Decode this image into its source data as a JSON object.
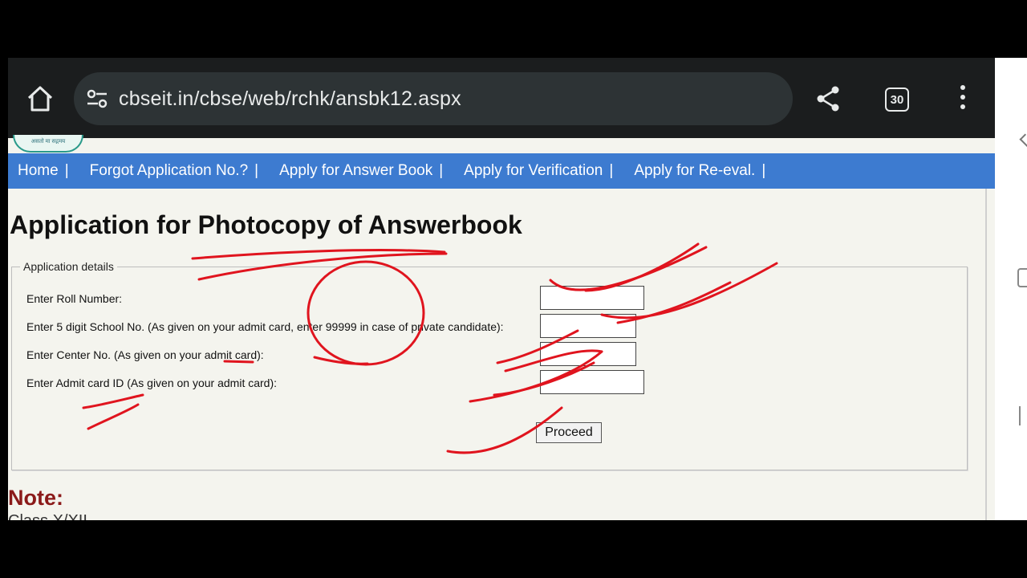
{
  "browser": {
    "url": "cbseit.in/cbse/web/rchk/ansbk12.aspx",
    "tab_count": "30"
  },
  "logo": {
    "caption": "असतो मा सद्गमय"
  },
  "nav": {
    "items": [
      {
        "label": "Home"
      },
      {
        "label": "Forgot Application No.?"
      },
      {
        "label": "Apply for Answer Book"
      },
      {
        "label": "Apply for Verification"
      },
      {
        "label": "Apply for Re-eval."
      }
    ],
    "separator": "|"
  },
  "page": {
    "title": "Application for Photocopy of Answerbook"
  },
  "form": {
    "legend": "Application details",
    "fields": [
      {
        "label": "Enter Roll Number:",
        "value": ""
      },
      {
        "label": "Enter 5 digit School No. (As given on your admit card, enter 99999 in case of private candidate):",
        "value": ""
      },
      {
        "label": "Enter Center No. (As given on your admit card):",
        "value": ""
      },
      {
        "label": "Enter Admit card ID (As given on your admit card):",
        "value": ""
      }
    ],
    "submit_label": "Proceed"
  },
  "note": {
    "title": "Note:",
    "partial_text": "Class X/XII"
  },
  "colors": {
    "nav_bar": "#3d7bd0",
    "annotation_ink": "#e0141e",
    "note_title": "#8b1a1a"
  }
}
